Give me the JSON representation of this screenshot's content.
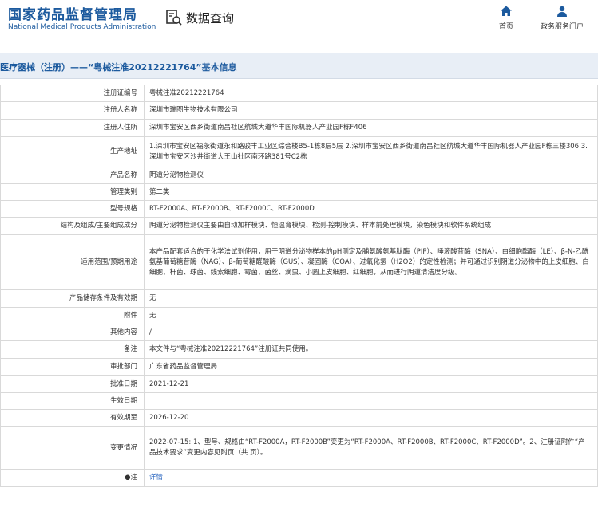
{
  "header": {
    "logo_cn": "国家药品监督管理局",
    "logo_en": "National Medical Products Administration",
    "search_title": "数据查询",
    "nav": [
      {
        "label": "首页",
        "icon": "home-icon"
      },
      {
        "label": "政务服务门户",
        "icon": "user-icon"
      }
    ]
  },
  "titlebar": {
    "text": "医疗器械（注册）——“粤械注准20212221764”基本信息"
  },
  "rows": [
    {
      "label": "注册证编号",
      "value": "粤械注准20212221764",
      "h": 21
    },
    {
      "label": "注册人名称",
      "value": "深圳市瑞图生物技术有限公司",
      "h": 22
    },
    {
      "label": "注册人住所",
      "value": "深圳市宝安区西乡街道南昌社区航城大道华丰国际机器人产业园F栋F406",
      "h": 22
    },
    {
      "label": "生产地址",
      "value": "1.深圳市宝安区福永街道永和路骏丰工业区综合楼B5-1栋8层5层 2.深圳市宝安区西乡街道南昌社区航城大道华丰国际机器人产业园F栋三楼306 3.深圳市宝安区沙井街道大王山社区南环路381号C2栋",
      "h": 38
    },
    {
      "label": "产品名称",
      "value": "阴道分泌物检测仪",
      "h": 21
    },
    {
      "label": "管理类别",
      "value": "第二类",
      "h": 21
    },
    {
      "label": "型号规格",
      "value": "RT-F2000A、RT-F2000B、RT-F2000C、RT-F2000D",
      "h": 21
    },
    {
      "label": "结构及组成/主要组成成分",
      "value": "阴道分泌物检测仪主要由自动加样模块、恒温育模块、检测-控制模块、样本前处理模块，染色模块和软件系统组成",
      "h": 22
    },
    {
      "label": "适用范围/预期用途",
      "value": "本产品配套适合的干化学法试剂使用，用于阴道分泌物样本的pH测定及脯氨酸氨基肽酶（PIP）、唾液酸苷酶（SNA）、白细胞酯酶（LE）、β-N-乙酰氨基葡萄糖苷酶（NAG）、β-葡萄糖醛酸酶（GUS）、凝固酶（COA）、过氧化氢（H2O2）的定性检测；并可通过识别阴道分泌物中的上皮细胞、白细胞、杆菌、球菌、线索细胞、霉菌、菌丝、滴虫、小圆上皮细胞、红细胞，从而进行阴道清洁度分级。",
      "h": 69
    },
    {
      "label": "产品储存条件及有效期",
      "value": "无",
      "h": 22
    },
    {
      "label": "附件",
      "value": "无",
      "h": 21
    },
    {
      "label": "其他内容",
      "value": "/",
      "h": 21
    },
    {
      "label": "备注",
      "value": "本文件与“粤械注准20212221764”注册证共同使用。",
      "h": 22
    },
    {
      "label": "审批部门",
      "value": "广东省药品监督管理局",
      "h": 22
    },
    {
      "label": "批准日期",
      "value": "2021-12-21",
      "h": 21
    },
    {
      "label": "生效日期",
      "value": "",
      "h": 21
    },
    {
      "label": "有效期至",
      "value": "2026-12-20",
      "h": 22
    },
    {
      "label": "变更情况",
      "value": "2022-07-15: 1、型号、规格由“RT-F2000A，RT-F2000B”变更为“RT-F2000A、RT-F2000B、RT-F2000C、RT-F2000D”。2、注册证附件“产品技术要求”变更内容见附页（共 页）。",
      "h": 53
    },
    {
      "label": "●注",
      "value": "详情",
      "h": 22,
      "link": true
    }
  ],
  "colors": {
    "brand": "#1c5a9e",
    "titlebar_bg": "#e8eef6",
    "link": "#2a66c0"
  }
}
